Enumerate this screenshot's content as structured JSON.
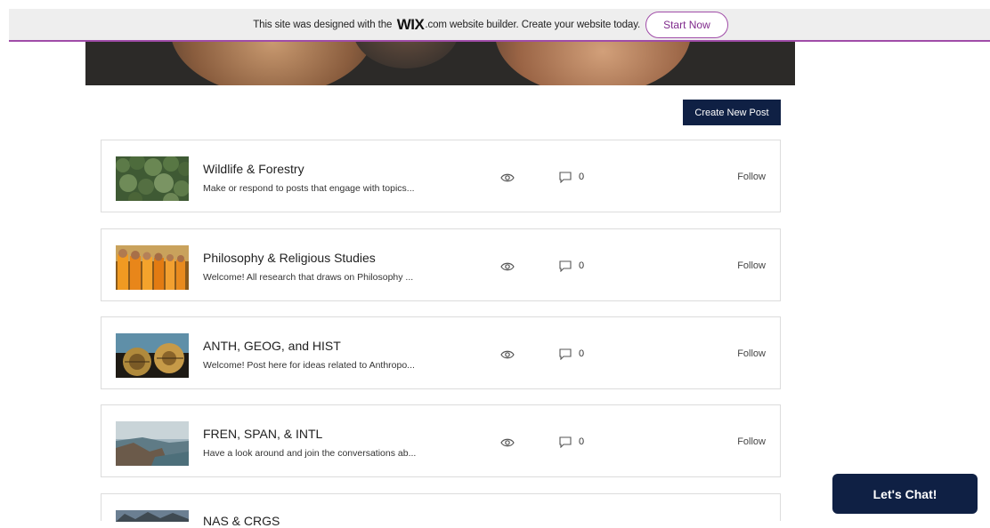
{
  "banner": {
    "text_before": "This site was designed with the",
    "logo": "WIX",
    "text_after": ".com website builder. Create your website today.",
    "cta": "Start Now"
  },
  "forum": {
    "create_post_label": "Create New Post",
    "categories": [
      {
        "title": "Wildlife & Forestry",
        "description": "Make or respond to posts that engage with topics...",
        "comments": "0",
        "follow": "Follow"
      },
      {
        "title": "Philosophy & Religious Studies",
        "description": "Welcome! All research that draws on Philosophy ...",
        "comments": "0",
        "follow": "Follow"
      },
      {
        "title": "ANTH, GEOG, and HIST",
        "description": "Welcome! Post here for ideas related to Anthropo...",
        "comments": "0",
        "follow": "Follow"
      },
      {
        "title": "FREN, SPAN, & INTL",
        "description": "Have a look around and join the conversations ab...",
        "comments": "0",
        "follow": "Follow"
      },
      {
        "title": "NAS & CRGS",
        "description": "",
        "comments": "",
        "follow": ""
      }
    ]
  },
  "chat": {
    "label": "Let's Chat!"
  },
  "colors": {
    "navy": "#0f2044",
    "wix_purple": "#a04ca8"
  }
}
